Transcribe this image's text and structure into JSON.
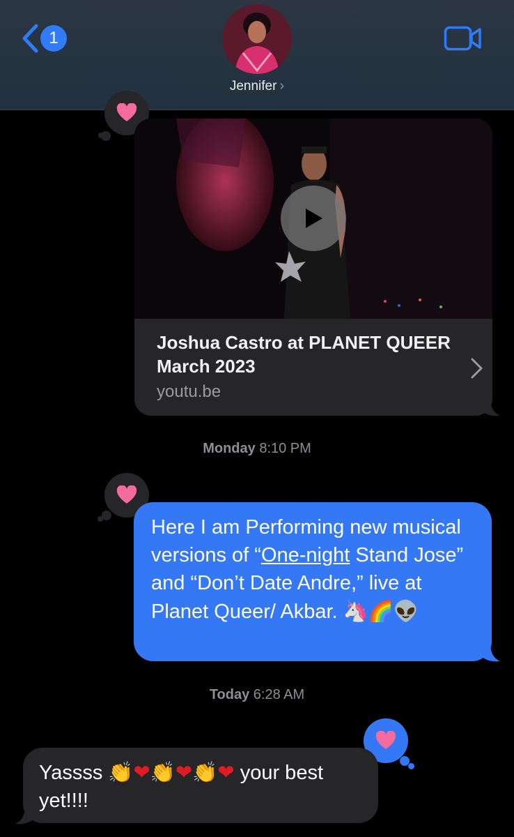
{
  "header": {
    "back_badge": "1",
    "contact_name": "Jennifer",
    "contact_chevron": "›",
    "icons": {
      "back": "chevron-left-icon",
      "video": "video-camera-icon"
    },
    "accent_color": "#2f7cf6"
  },
  "messages": {
    "link_preview": {
      "title": "Joshua Castro at PLANET QUEER March 2023",
      "domain": "youtu.be",
      "tapback": "heart-icon",
      "play_icon": "play-icon"
    },
    "timestamp_1": {
      "day": "Monday",
      "time": "8:10 PM"
    },
    "outgoing": {
      "text_part1": "Here I am Performing new musical versions of “",
      "text_link": "One-night",
      "text_part2": " Stand Jose” and “Don’t Date Andre,” live at Planet Queer/ Akbar. ",
      "emojis": "🦄🌈👽",
      "tapback": "heart-icon",
      "bubble_color": "#3478f6"
    },
    "timestamp_2": {
      "day": "Today",
      "time": "6:28 AM"
    },
    "incoming": {
      "text_start": "Yassss ",
      "clap": "👏",
      "heart": "❤",
      "text_end": " your best yet!!!!",
      "tapback": "heart-icon"
    }
  }
}
